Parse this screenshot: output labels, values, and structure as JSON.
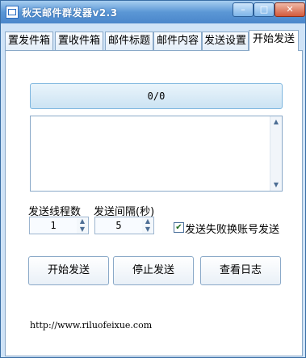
{
  "window": {
    "title": "秋天邮件群发器v2.3"
  },
  "controls": {
    "minimize": "–",
    "maximize": "□",
    "close": "✕"
  },
  "tabs": [
    {
      "label": "置发件箱"
    },
    {
      "label": "置收件箱"
    },
    {
      "label": "邮件标题"
    },
    {
      "label": "邮件内容"
    },
    {
      "label": "发送设置"
    },
    {
      "label": "开始发送",
      "active": true
    }
  ],
  "progress": {
    "text": "0/0",
    "value": 0
  },
  "log": {
    "content": ""
  },
  "settings": {
    "threads_label": "发送线程数",
    "threads_value": "1",
    "interval_label": "发送间隔(秒)",
    "interval_value": "5",
    "failover_label": "发送失败换账号发送",
    "failover_checked": true
  },
  "buttons": {
    "start": "开始发送",
    "stop": "停止发送",
    "view_log": "查看日志"
  },
  "footer": {
    "url": "http://www.riluofeixue.com"
  }
}
